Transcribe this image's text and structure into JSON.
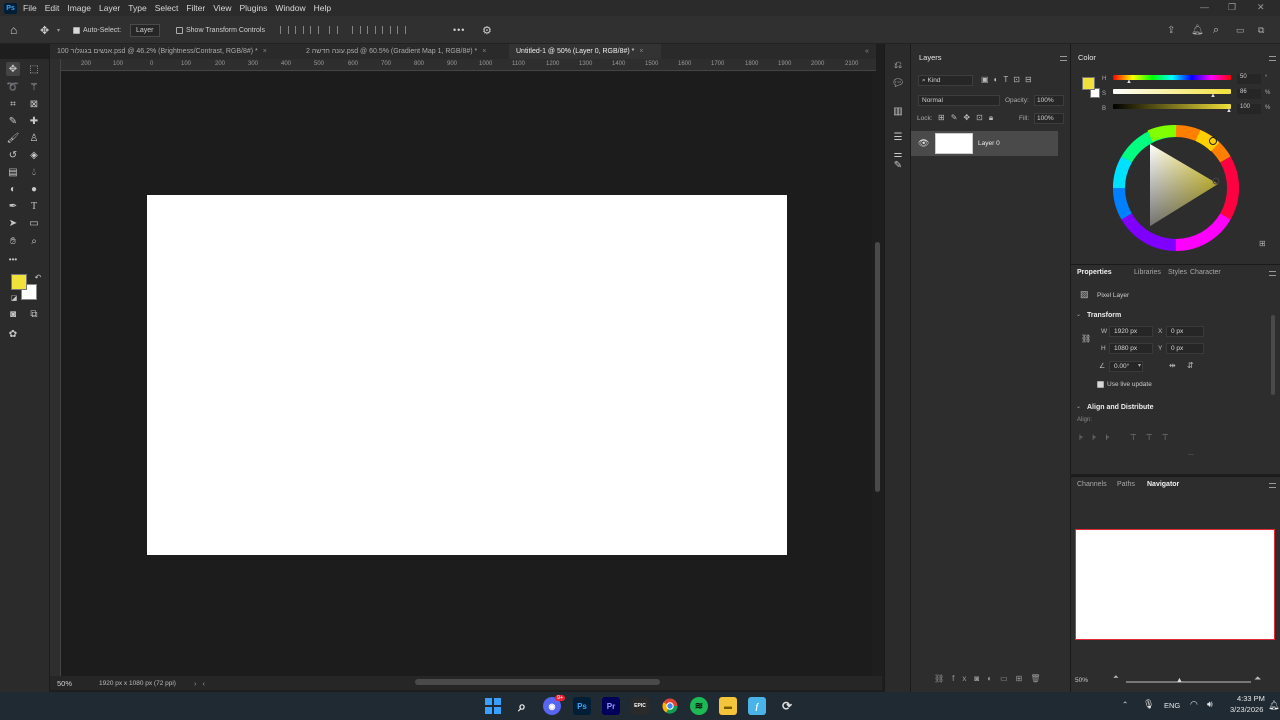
{
  "app": {
    "logo": "Ps"
  },
  "menu": [
    "File",
    "Edit",
    "Image",
    "Layer",
    "Type",
    "Select",
    "Filter",
    "View",
    "Plugins",
    "Window",
    "Help"
  ],
  "options_bar": {
    "auto_select_label": "Auto-Select:",
    "auto_select_checked": true,
    "auto_select_target": "Layer",
    "show_transform_label": "Show Transform Controls",
    "more_label": "•••"
  },
  "tabs": [
    {
      "label": "100 אנשים בגוגלור.psd @ 46.2% (Brightness/Contrast, RGB/8#) *",
      "close": "×",
      "active": false
    },
    {
      "label": "2 עונה חדשה.psd @ 60.5% (Gradient Map 1, RGB/8#) *",
      "close": "×",
      "active": false
    },
    {
      "label": "Untitled-1 @ 50% (Layer 0, RGB/8#) *",
      "close": "×",
      "active": true
    }
  ],
  "ruler_ticks": [
    "200",
    "100",
    "0",
    "100",
    "200",
    "300",
    "400",
    "500",
    "600",
    "700",
    "800",
    "900",
    "1000",
    "1100",
    "1200",
    "1300",
    "1400",
    "1500",
    "1600",
    "1700",
    "1800",
    "1900",
    "2000",
    "2100"
  ],
  "status_bar": {
    "zoom": "50%",
    "doc_info": "1920 px x 1080 px (72 ppi)"
  },
  "layers_panel": {
    "title": "Layers",
    "filter_kind": "Kind",
    "blend_mode": "Normal",
    "opacity_label": "Opacity:",
    "opacity_value": "100%",
    "lock_label": "Lock:",
    "fill_label": "Fill:",
    "fill_value": "100%",
    "layers": [
      {
        "name": "Layer 0",
        "visible": true
      }
    ]
  },
  "color_panel": {
    "title": "Color",
    "foreground": "#f2e13a",
    "background": "#ffffff",
    "h_label": "H",
    "s_label": "S",
    "b_label": "B",
    "h_value": "50",
    "s_value": "86",
    "b_value": "100",
    "unit_h": "°",
    "unit_s": "%",
    "unit_b": "%"
  },
  "properties_panel": {
    "tabs": [
      "Properties",
      "Libraries",
      "Styles",
      "Character"
    ],
    "layer_type": "Pixel Layer",
    "transform_title": "Transform",
    "w_label": "W",
    "w_value": "1920 px",
    "h_label": "H",
    "h_value": "1080 px",
    "x_label": "X",
    "x_value": "0 px",
    "y_label": "Y",
    "y_value": "0 px",
    "angle_value": "0.00°",
    "live_update_label": "Use live update",
    "live_update_checked": true,
    "align_title": "Align and Distribute",
    "align_label": "Align:",
    "more": "..."
  },
  "navigator_panel": {
    "tabs": [
      "Channels",
      "Paths",
      "Navigator"
    ],
    "zoom": "50%"
  },
  "taskbar": {
    "time": "4:33 PM",
    "date": "3/23/2026",
    "lang": "ENG",
    "discord_badge": "9+",
    "apps": [
      "windows-start",
      "search",
      "discord",
      "photoshop",
      "premiere",
      "epic-games",
      "chrome",
      "spotify",
      "file-explorer",
      "flash",
      "other"
    ]
  }
}
